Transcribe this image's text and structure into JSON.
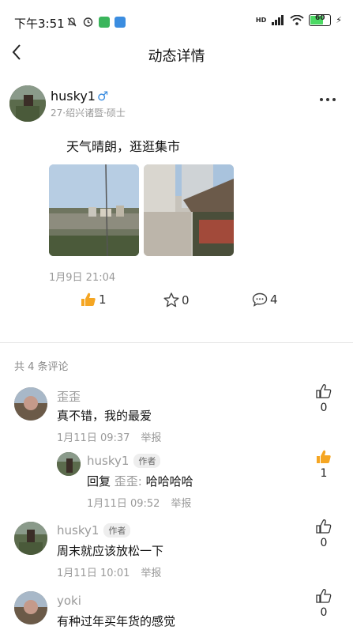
{
  "status_bar": {
    "time": "下午3:51",
    "battery": "60",
    "network": "HD"
  },
  "header": {
    "title": "动态详情"
  },
  "post": {
    "username": "husky1",
    "gender_symbol": "♂",
    "meta": "27·绍兴诸暨·硕士",
    "text": "天气晴朗，逛逛集市",
    "date": "1月9日 21:04",
    "likes": "1",
    "favorites": "0",
    "comments": "4"
  },
  "comments_header": "共 4 条评论",
  "comments": [
    {
      "name": "歪歪",
      "text": "真不错，我的最爱",
      "time": "1月11日 09:37",
      "report": "举报",
      "likes": "0"
    },
    {
      "name": "husky1",
      "tag": "作者",
      "reply_prefix": "回复",
      "reply_to": "歪歪:",
      "text": "哈哈哈哈",
      "time": "1月11日 09:52",
      "report": "举报",
      "likes": "1"
    },
    {
      "name": "husky1",
      "tag": "作者",
      "text": "周末就应该放松一下",
      "time": "1月11日 10:01",
      "report": "举报",
      "likes": "0"
    },
    {
      "name": "yoki",
      "text": "有种过年买年货的感觉",
      "likes": "0"
    }
  ],
  "colors": {
    "like_active": "#f5a623",
    "divider": "#e6e6e6"
  }
}
